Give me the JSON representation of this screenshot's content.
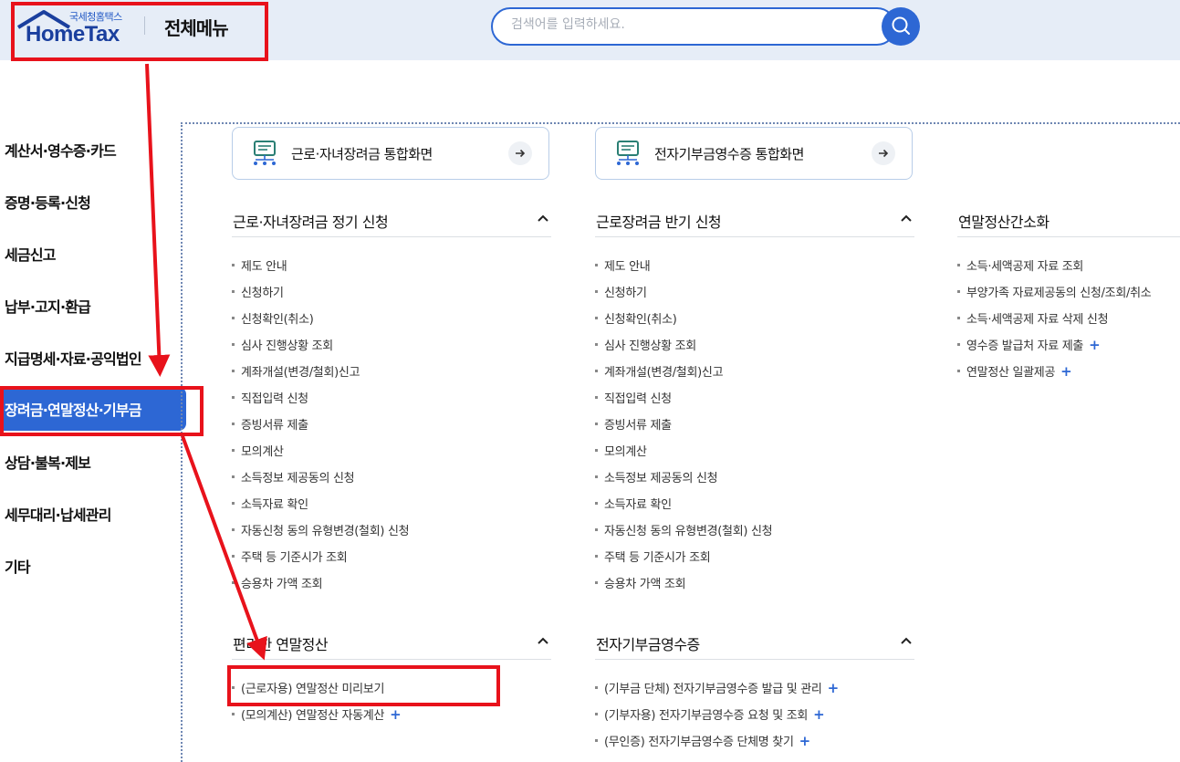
{
  "header": {
    "logo_small": "국세청홈택스",
    "logo_big": "HomeTax",
    "menu_title": "전체메뉴",
    "search_placeholder": "검색어를 입력하세요."
  },
  "nav": {
    "items": [
      {
        "label": "계산서·영수증·카드"
      },
      {
        "label": "증명·등록·신청"
      },
      {
        "label": "세금신고"
      },
      {
        "label": "납부·고지·환급"
      },
      {
        "label": "지급명세·자료·공익법인"
      },
      {
        "label": "장려금·연말정산·기부금"
      },
      {
        "label": "상담·불복·제보"
      },
      {
        "label": "세무대리·납세관리"
      },
      {
        "label": "기타"
      }
    ]
  },
  "quick_cards": [
    {
      "label": "근로·자녀장려금 통합화면"
    },
    {
      "label": "전자기부금영수증 통합화면"
    }
  ],
  "sections": {
    "s1": {
      "title": "근로·자녀장려금 정기 신청",
      "items": [
        "제도 안내",
        "신청하기",
        "신청확인(취소)",
        "심사 진행상황 조회",
        "계좌개설(변경/철회)신고",
        "직접입력 신청",
        "증빙서류 제출",
        "모의계산",
        "소득정보 제공동의 신청",
        "소득자료 확인",
        "자동신청 동의 유형변경(철회) 신청",
        "주택 등 기준시가 조회",
        "승용차 가액 조회"
      ]
    },
    "s2": {
      "title": "근로장려금 반기 신청",
      "items": [
        "제도 안내",
        "신청하기",
        "신청확인(취소)",
        "심사 진행상황 조회",
        "계좌개설(변경/철회)신고",
        "직접입력 신청",
        "증빙서류 제출",
        "모의계산",
        "소득정보 제공동의 신청",
        "소득자료 확인",
        "자동신청 동의 유형변경(철회) 신청",
        "주택 등 기준시가 조회",
        "승용차 가액 조회"
      ]
    },
    "s3": {
      "title": "연말정산간소화",
      "items": [
        "소득·세액공제 자료 조회",
        "부양가족 자료제공동의 신청/조회/취소",
        "소득·세액공제 자료 삭제 신청",
        "영수증 발급처 자료 제출",
        "연말정산 일괄제공"
      ],
      "plus": [
        "",
        "",
        "",
        "+",
        "+"
      ]
    },
    "s4": {
      "title": "편리한 연말정산",
      "items": [
        "(근로자용) 연말정산 미리보기",
        "(모의계산) 연말정산 자동계산"
      ],
      "plus": [
        "",
        "+"
      ]
    },
    "s5": {
      "title": "전자기부금영수증",
      "items": [
        "(기부금 단체) 전자기부금영수증 발급 및 관리",
        "(기부자용) 전자기부금영수증 요청 및 조회",
        "(무인증) 전자기부금영수증 단체명 찾기"
      ],
      "plus": [
        "+",
        "+",
        "+"
      ]
    }
  },
  "colors": {
    "accent": "#2d67d4",
    "highlight_red": "#e8121b",
    "header_bg": "#e6edf7"
  }
}
